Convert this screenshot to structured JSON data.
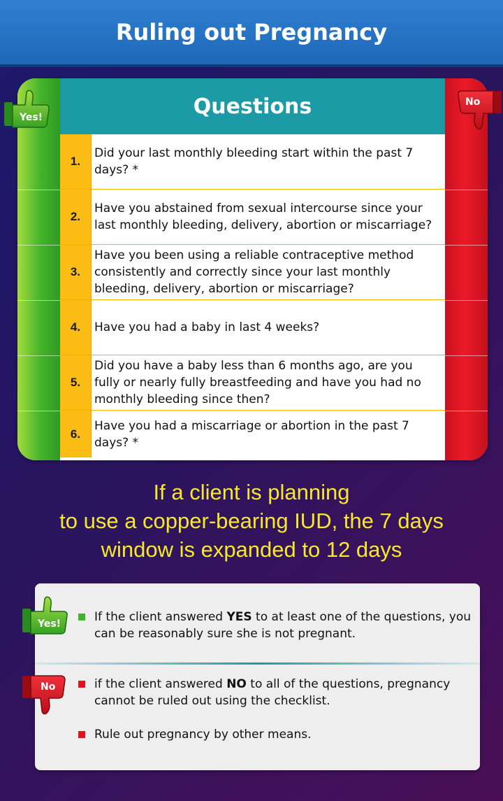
{
  "header": {
    "title": "Ruling out Pregnancy"
  },
  "table": {
    "heading": "Questions",
    "yes_label": "Yes!",
    "no_label": "No",
    "questions": [
      {
        "num": "1.",
        "text": "Did your last monthly bleeding start within the past 7 days? *"
      },
      {
        "num": "2.",
        "text": "Have you abstained from sexual intercourse since your last monthly bleeding, delivery, abortion or miscarriage?"
      },
      {
        "num": "3.",
        "text": "Have you been using a reliable contraceptive method consistently and correctly since your last monthly bleeding, delivery, abortion or miscarriage?"
      },
      {
        "num": "4.",
        "text": "Have you had a baby in last 4 weeks?"
      },
      {
        "num": "5.",
        "text": "Did you have a baby less than 6 months ago, are you fully or nearly fully breastfeeding and have you had no monthly bleeding since then?"
      },
      {
        "num": "6.",
        "text": "Have you had a miscarriage or abortion in the past 7 days? *"
      }
    ]
  },
  "note": {
    "line1": "If a client is planning",
    "line2": "to use a copper-bearing IUD, the 7 days",
    "line3": "window is expanded to 12 days"
  },
  "summary": {
    "yes_label": "Yes!",
    "no_label": "No",
    "yes_pre": "If the client answered ",
    "yes_bold": "YES",
    "yes_post": " to at least one of the questions, you can be reasonably sure she is not pregnant.",
    "no_pre": "if the client answered ",
    "no_bold": "NO",
    "no_post": " to all of the questions, pregnancy cannot be ruled out using the checklist.",
    "no_extra": "Rule out pregnancy by other means."
  },
  "colors": {
    "header_blue": "#1f68b9",
    "teal": "#1c9aa6",
    "yes_green": "#43b32a",
    "no_red": "#ec1a28",
    "number_yellow": "#fbbd13",
    "note_yellow": "#f7e92a"
  },
  "icons": {
    "yes": "thumbs-up-icon",
    "no": "thumbs-down-icon"
  }
}
